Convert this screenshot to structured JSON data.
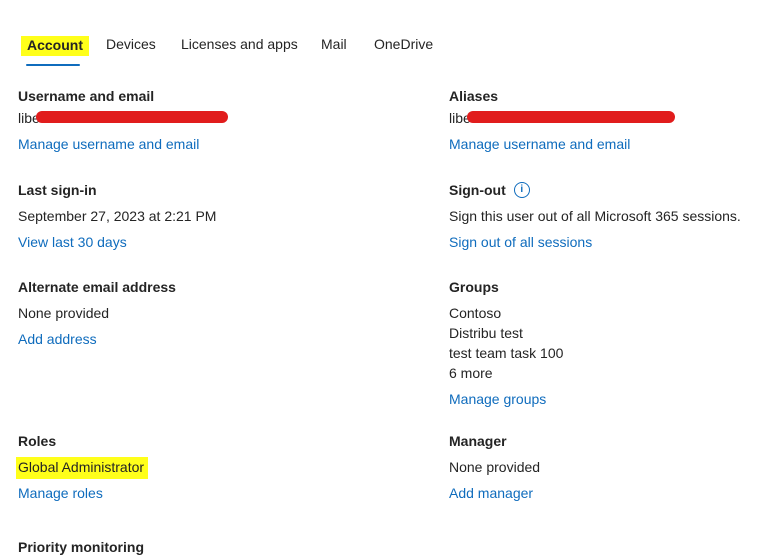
{
  "tabs": [
    {
      "label": "Account",
      "active": true
    },
    {
      "label": "Devices"
    },
    {
      "label": "Licenses and apps"
    },
    {
      "label": "Mail"
    },
    {
      "label": "OneDrive"
    }
  ],
  "colors": {
    "link": "#0f6cbd",
    "highlight": "#ffff1a",
    "redaction": "#e11c1c"
  },
  "username": {
    "label": "Username and email",
    "value_prefix": "libe",
    "link": "Manage username and email"
  },
  "aliases": {
    "label": "Aliases",
    "value_prefix": "libe",
    "link": "Manage username and email"
  },
  "last_signin": {
    "label": "Last sign-in",
    "value": "September 27, 2023 at 2:21 PM",
    "link": "View last 30 days"
  },
  "signout": {
    "label": "Sign-out",
    "icon": "info-icon",
    "value": "Sign this user out of all Microsoft 365 sessions.",
    "link": "Sign out of all sessions"
  },
  "alt_email": {
    "label": "Alternate email address",
    "value": "None provided",
    "link": "Add address"
  },
  "groups": {
    "label": "Groups",
    "items": [
      "Contoso",
      "Distribu test",
      "test team task 100",
      "6 more"
    ],
    "link": "Manage groups"
  },
  "roles": {
    "label": "Roles",
    "value": "Global Administrator",
    "link": "Manage roles"
  },
  "manager": {
    "label": "Manager",
    "value": "None provided",
    "link": "Add manager"
  },
  "priority": {
    "label": "Priority monitoring"
  }
}
